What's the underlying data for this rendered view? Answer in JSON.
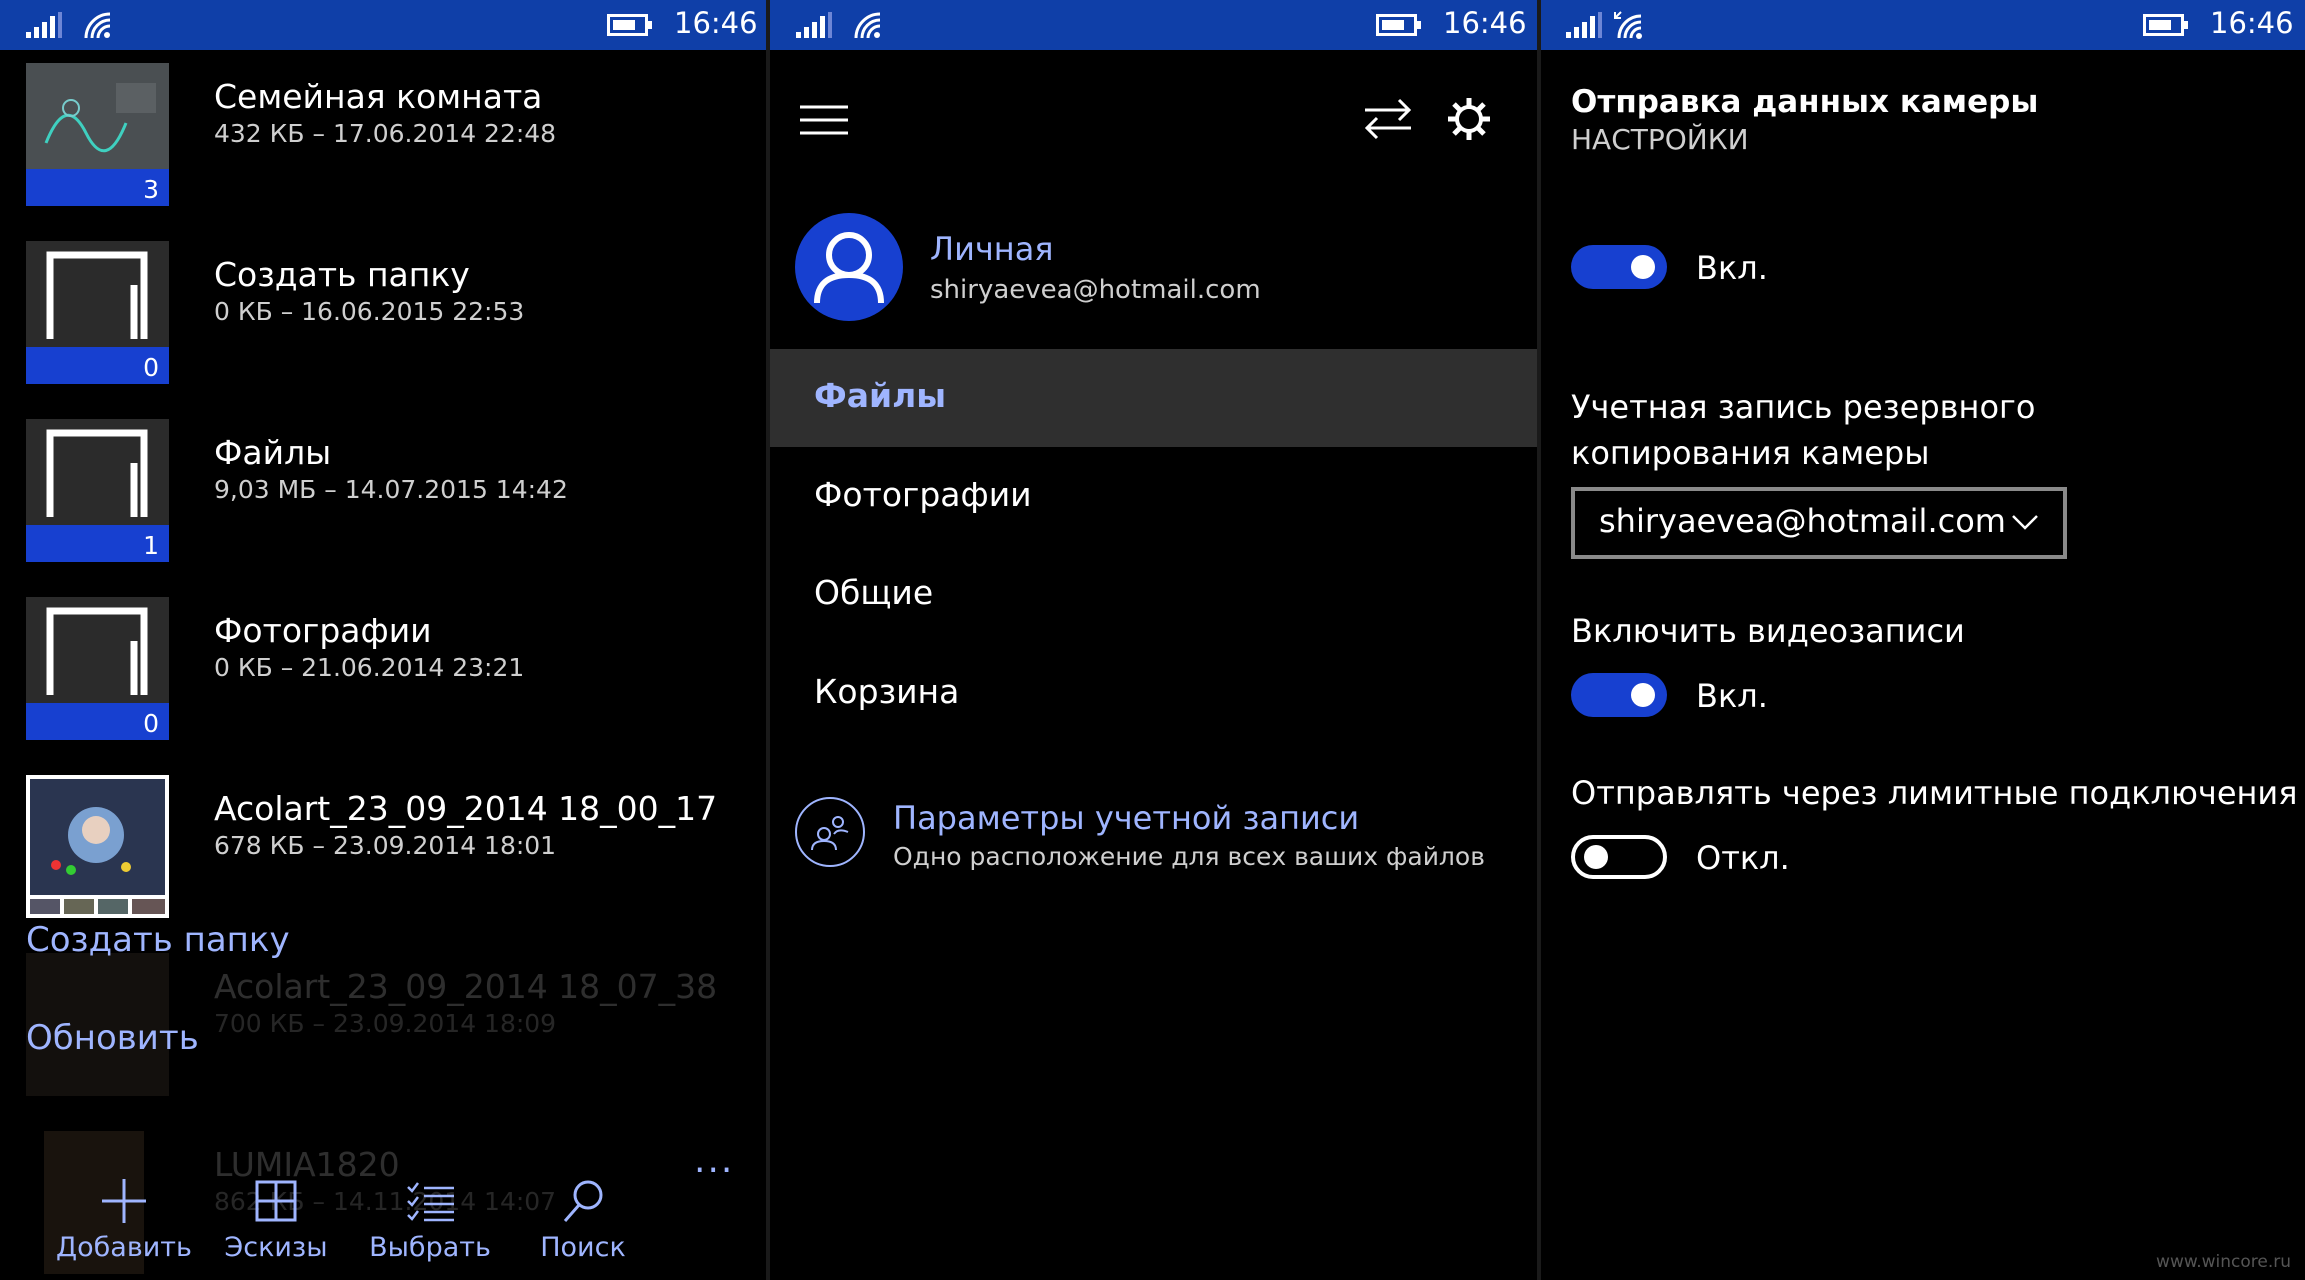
{
  "status_bar": {
    "time": "16:46"
  },
  "files_panel": {
    "items": [
      {
        "name": "Семейная комната",
        "meta": "432 КБ – 17.06.2014 22:48",
        "count": "3"
      },
      {
        "name": "Создать папку",
        "meta": "0 КБ – 16.06.2015 22:53",
        "count": "0"
      },
      {
        "name": "Файлы",
        "meta": "9,03 МБ – 14.07.2015 14:42",
        "count": "1"
      },
      {
        "name": "Фотографии",
        "meta": "0 КБ – 21.06.2014 23:21",
        "count": "0"
      },
      {
        "name": "Acolart_23_09_2014 18_00_17",
        "meta": "678 КБ – 23.09.2014 18:01"
      },
      {
        "name": "Acolart_23_09_2014 18_07_38",
        "meta": "700 КБ – 23.09.2014 18:09"
      },
      {
        "name": "LUMIA1820",
        "meta": "862 КБ – 14.11.2014 14:07"
      }
    ],
    "context_menu": {
      "create_folder": "Создать папку",
      "refresh": "Обновить"
    },
    "app_bar": {
      "add": "Добавить",
      "thumbnails": "Эскизы",
      "select": "Выбрать",
      "search": "Поиск",
      "more": "···"
    }
  },
  "menu_panel": {
    "account": {
      "type": "Личная",
      "email": "shiryaevea@hotmail.com"
    },
    "nav": [
      {
        "label": "Файлы"
      },
      {
        "label": "Фотографии"
      },
      {
        "label": "Общие"
      },
      {
        "label": "Корзина"
      }
    ],
    "account_settings": {
      "title": "Параметры учетной записи",
      "subtitle": "Одно расположение для всех ваших файлов"
    }
  },
  "settings_panel": {
    "title": "Отправка данных камеры",
    "subtitle": "НАСТРОЙКИ",
    "camera_upload": {
      "state": "Вкл.",
      "on": true
    },
    "backup_account_label": "Учетная запись резервного копирования камеры",
    "backup_account_value": "shiryaevea@hotmail.com",
    "video_label": "Включить видеозаписи",
    "video": {
      "state": "Вкл.",
      "on": true
    },
    "metered_label": "Отправлять через лимитные подключения",
    "metered": {
      "state": "Откл.",
      "on": false
    }
  },
  "watermark": "www.wincore.ru",
  "colors": {
    "status_bar": "#0f3fa8",
    "accent": "#1740d0",
    "accent_text": "#9fb5ff",
    "background": "#000000"
  }
}
